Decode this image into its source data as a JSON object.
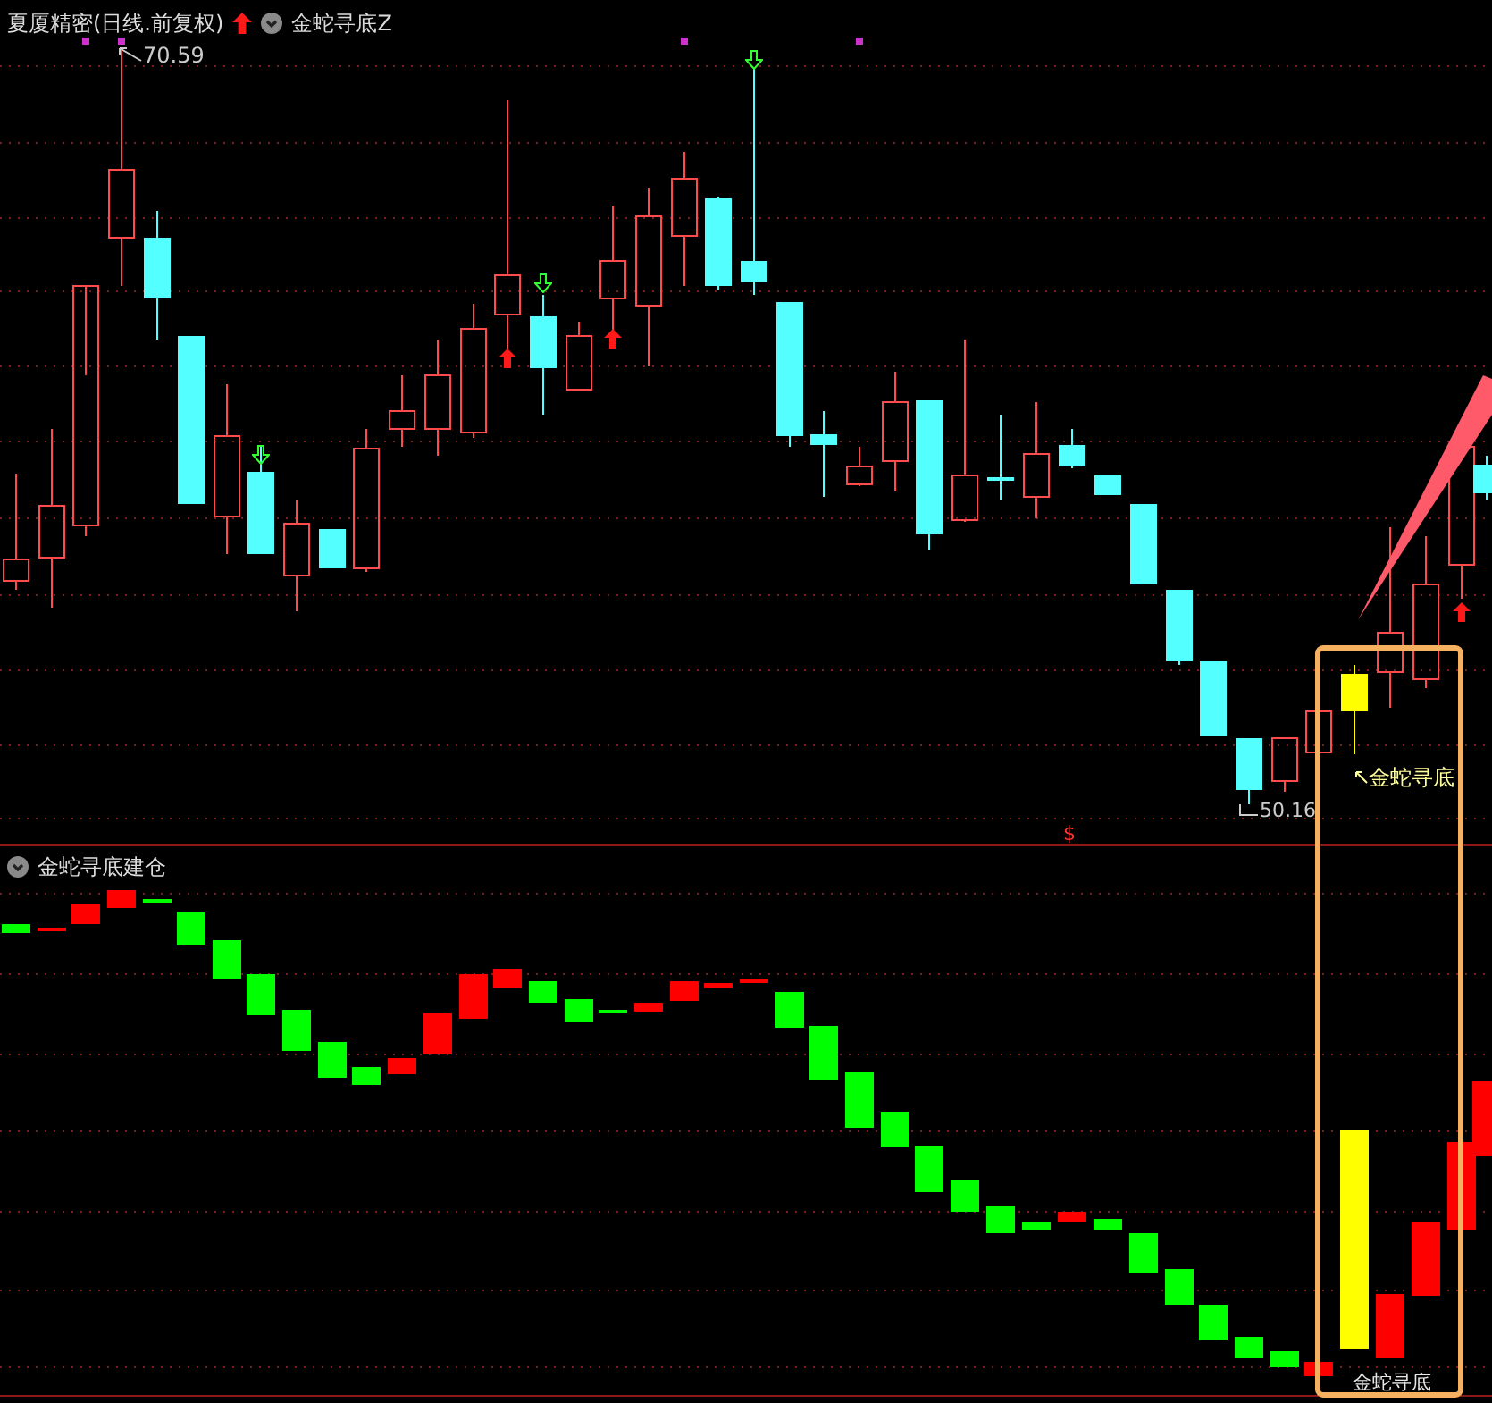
{
  "price_panel": {
    "title": "夏厦精密(日线.前复权)",
    "indicator": "金蛇寻底Z",
    "high_label": "70.59",
    "low_label": "50.16",
    "signal_label": "金蛇寻底",
    "marker": "$"
  },
  "indicator_panel": {
    "title": "金蛇寻底建仓",
    "signal_label": "金蛇寻底"
  }
}
